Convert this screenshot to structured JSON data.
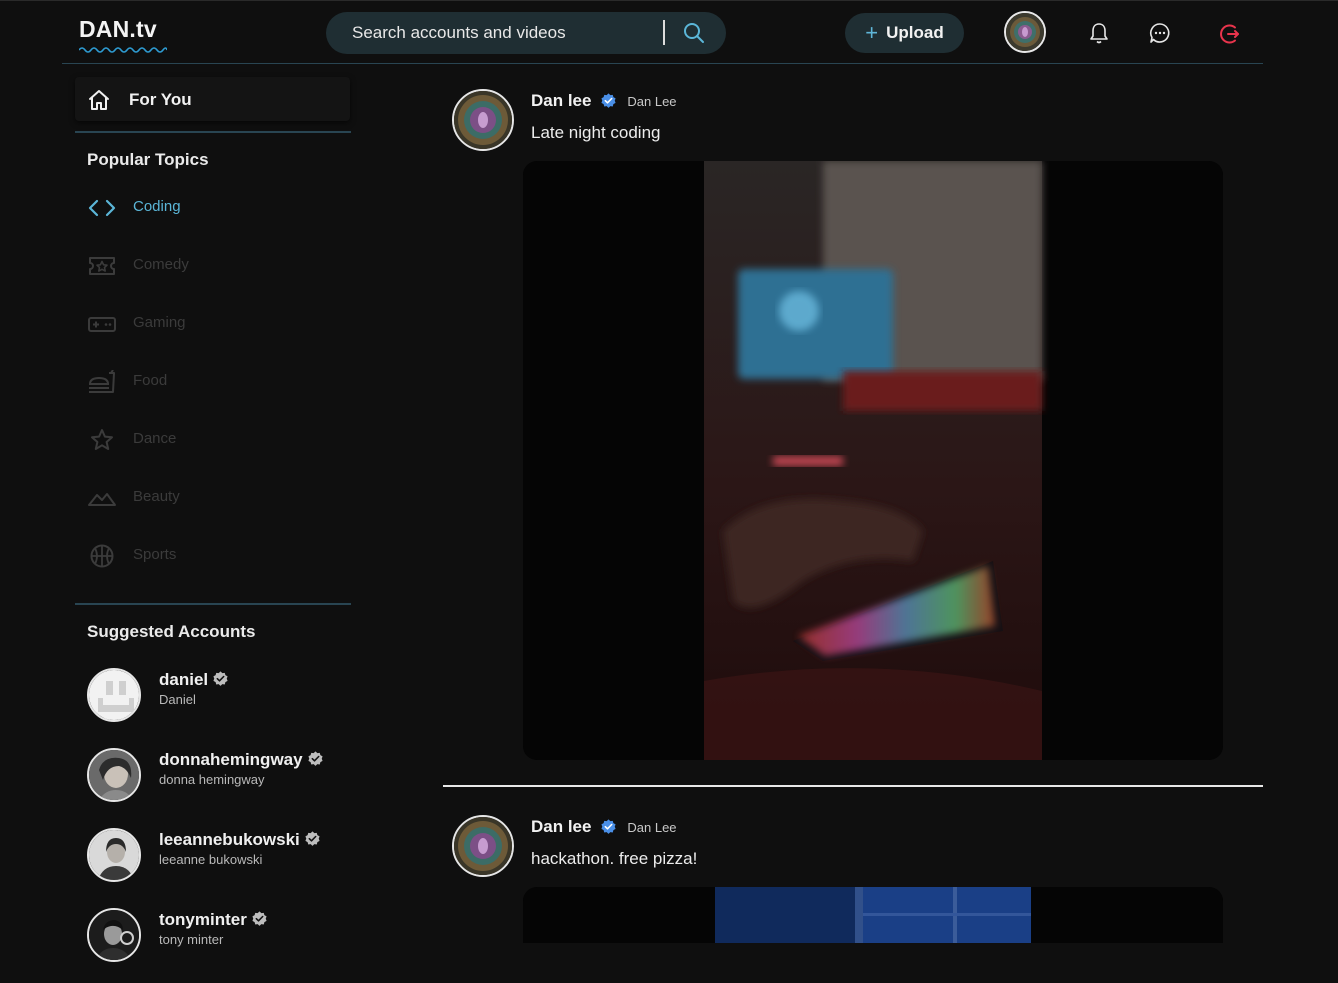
{
  "app": {
    "logo": "DAN.tv"
  },
  "header": {
    "search_placeholder": "Search accounts and videos",
    "upload_label": "Upload",
    "icons": [
      "search-icon",
      "plus-icon",
      "bell-icon",
      "chat-icon",
      "logout-icon"
    ]
  },
  "sidebar": {
    "for_you": "For You",
    "topics_title": "Popular Topics",
    "topics": [
      {
        "label": "Coding",
        "icon": "code-icon",
        "active": true
      },
      {
        "label": "Comedy",
        "icon": "ticket-star-icon",
        "active": false
      },
      {
        "label": "Gaming",
        "icon": "gamepad-icon",
        "active": false
      },
      {
        "label": "Food",
        "icon": "fastfood-icon",
        "active": false
      },
      {
        "label": "Dance",
        "icon": "star-icon",
        "active": false
      },
      {
        "label": "Beauty",
        "icon": "mountain-icon",
        "active": false
      },
      {
        "label": "Sports",
        "icon": "basketball-icon",
        "active": false
      }
    ],
    "accounts_title": "Suggested Accounts",
    "accounts": [
      {
        "username": "daniel",
        "display_name": "Daniel"
      },
      {
        "username": "donnahemingway",
        "display_name": "donna hemingway"
      },
      {
        "username": "leeannebukowski",
        "display_name": "leeanne bukowski"
      },
      {
        "username": "tonyminter",
        "display_name": "tony minter"
      }
    ]
  },
  "feed": {
    "posts": [
      {
        "name": "Dan lee",
        "handle": "Dan Lee",
        "caption": "Late night coding"
      },
      {
        "name": "Dan lee",
        "handle": "Dan Lee",
        "caption": "hackathon. free pizza!"
      }
    ]
  },
  "colors": {
    "background": "#0f0f0f",
    "accent": "#5bb6d8",
    "verified": "#4a8fe7",
    "logout": "#e8344c",
    "panel": "#1f2e33"
  }
}
